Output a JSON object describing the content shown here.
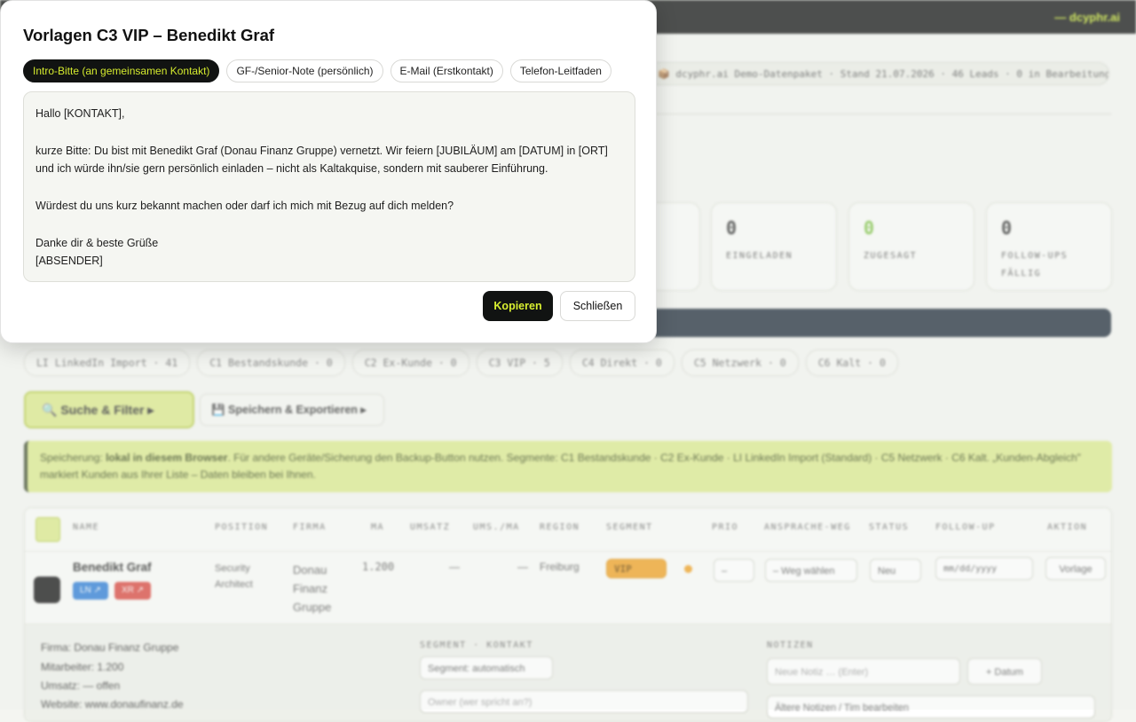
{
  "app": {
    "brand": "— dcyphr.ai",
    "info_pill": "📦 dcyphr.ai Demo-Datenpaket · Stand 21.07.2026 · 46 Leads · 0 in Bearbeitung"
  },
  "kpis": [
    {
      "value": "0",
      "label": "EINGELADEN",
      "color": "#555555"
    },
    {
      "value": "0",
      "label": "ZUGESAGT",
      "color": "#7cc242"
    },
    {
      "value": "0",
      "label": "FOLLOW-UPS FÄLLIG",
      "color": "#555555"
    }
  ],
  "segments": [
    "LI LinkedIn Import · 41",
    "C1 Bestandskunde · 0",
    "C2 Ex-Kunde · 0",
    "C3 VIP · 5",
    "C4 Direkt · 0",
    "C5 Netzwerk · 0",
    "C6 Kalt · 0"
  ],
  "toolbar": {
    "filter_label": "🔍  Suche & Filter  ▸",
    "export_label": "💾  Speichern & Exportieren  ▸"
  },
  "notice": {
    "prefix": "Speicherung: ",
    "bold": "lokal in diesem Browser",
    "text": ". Für andere Geräte/Sicherung den Backup-Button nutzen. Segmente: C1 Bestandskunde · C2 Ex-Kunde · LI LinkedIn Import (Standard) · C5 Netzwerk · C6 Kalt. „Kunden-Abgleich\" markiert Kunden aus Ihrer Liste – Daten bleiben bei Ihnen."
  },
  "table": {
    "headers": [
      "NAME",
      "POSITION",
      "FIRMA",
      "MA",
      "UMSATZ",
      "UMS./MA",
      "REGION",
      "SEGMENT",
      "PRIO",
      "ANSPRACHE-WEG",
      "STATUS",
      "FOLLOW-UP",
      "AKTION"
    ],
    "row": {
      "name": "Benedikt Graf",
      "tag1": "LN ↗",
      "tag2": "XR ↗",
      "position": "Security Architect",
      "firma": "Donau Finanz Gruppe",
      "ma": "1.200",
      "umsatz": "—",
      "ums_ma": "—",
      "region": "Freiburg",
      "segment": "VIP",
      "prio": "–",
      "weg": "– Weg wählen",
      "status": "Neu",
      "followup": "mm/dd/yyyy",
      "aktion": "Vorlage"
    },
    "detail": {
      "firma": "Firma: Donau Finanz Gruppe",
      "mitarbeiter": "Mitarbeiter: 1.200",
      "umsatz": "Umsatz: — offen",
      "website": "Website: www.donaufinanz.de",
      "segment_title": "SEGMENT · KONTAKT",
      "segment_select": "Segment: automatisch",
      "owner_placeholder": "Owner (wer spricht an?)",
      "notes_title": "NOTIZEN",
      "note_placeholder": "Neue Notiz … (Enter)",
      "date_button": "+ Datum",
      "older_notes": "Ältere Notizen / Tim bearbeiten"
    }
  },
  "modal": {
    "title": "Vorlagen C3 VIP – Benedikt Graf",
    "tabs": [
      {
        "label": "Intro-Bitte (an gemeinsamen Kontakt)",
        "active": true
      },
      {
        "label": "GF-/Senior-Note (persönlich)",
        "active": false
      },
      {
        "label": "E-Mail (Erstkontakt)",
        "active": false
      },
      {
        "label": "Telefon-Leitfaden",
        "active": false
      }
    ],
    "template_text": "Hallo [KONTAKT],\n\nkurze Bitte: Du bist mit Benedikt Graf (Donau Finanz Gruppe) vernetzt. Wir feiern [JUBILÄUM] am [DATUM] in [ORT] und ich würde ihn/sie gern persönlich einladen – nicht als Kaltakquise, sondern mit sauberer Einführung.\n\nWürdest du uns kurz bekannt machen oder darf ich mich mit Bezug auf dich melden?\n\nDanke dir & beste Grüße\n[ABSENDER]",
    "copy_label": "Kopieren",
    "close_label": "Schließen"
  },
  "colors": {
    "accent": "#d4ea2e",
    "dark": "#111312",
    "vip": "#f0a020"
  }
}
